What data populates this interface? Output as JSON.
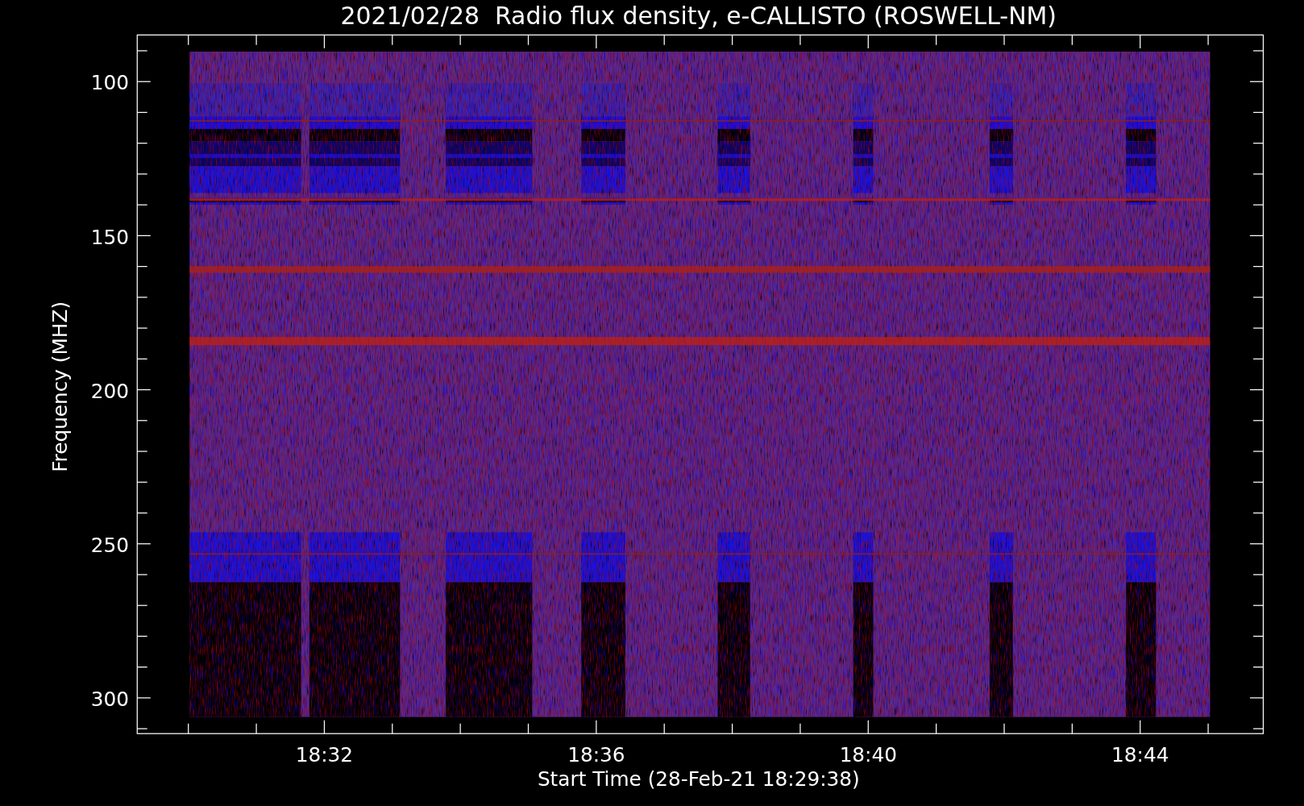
{
  "plot": {
    "title": "2021/02/28  Radio flux density, e-CALLISTO (ROSWELL-NM)",
    "y_axis": {
      "label": "Frequency (MHZ)",
      "tick_labels": [
        "100",
        "150",
        "200",
        "250",
        "300"
      ]
    },
    "x_axis": {
      "label": "Start Time (28-Feb-21 18:29:38)",
      "tick_labels": [
        "18:32",
        "18:36",
        "18:40",
        "18:44"
      ]
    }
  }
}
